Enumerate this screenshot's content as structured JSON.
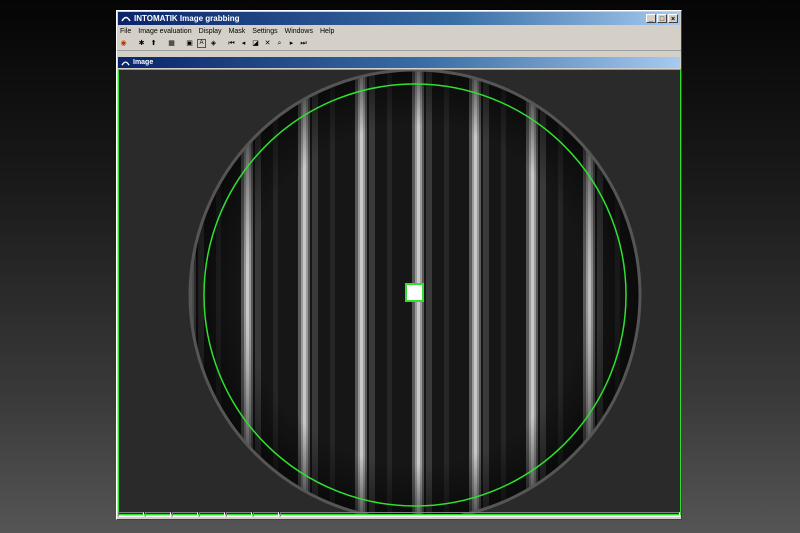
{
  "window": {
    "title": "INTOMATIK Image grabbing",
    "minimize": "_",
    "maximize": "□",
    "close": "×"
  },
  "menu": [
    "File",
    "Image evaluation",
    "Display",
    "Mask",
    "Settings",
    "Windows",
    "Help"
  ],
  "toolbar": {
    "icons": [
      "record-icon",
      "grab-icon",
      "upload-icon",
      "grid-icon",
      "image-icon",
      "text-image-icon",
      "target-icon",
      "first-icon",
      "prev-icon",
      "invert-icon",
      "delete-icon",
      "zoom-icon",
      "next-icon",
      "last-icon"
    ],
    "glyphs": [
      "◉",
      "✱",
      "⬆",
      "▦",
      "▣",
      "A",
      "◈",
      "⏮",
      "◂",
      "◪",
      "✕",
      "⌕",
      "▸",
      "⏭"
    ]
  },
  "image_window": {
    "title": "Image"
  },
  "colors": {
    "title_dark": "#0a246a",
    "title_light": "#a6caf0",
    "overlay_green": "#2fe02f",
    "chrome": "#d4d0c8"
  },
  "interferogram": {
    "fringe_count": 8,
    "mask_shape": "circle",
    "marker": "square"
  }
}
